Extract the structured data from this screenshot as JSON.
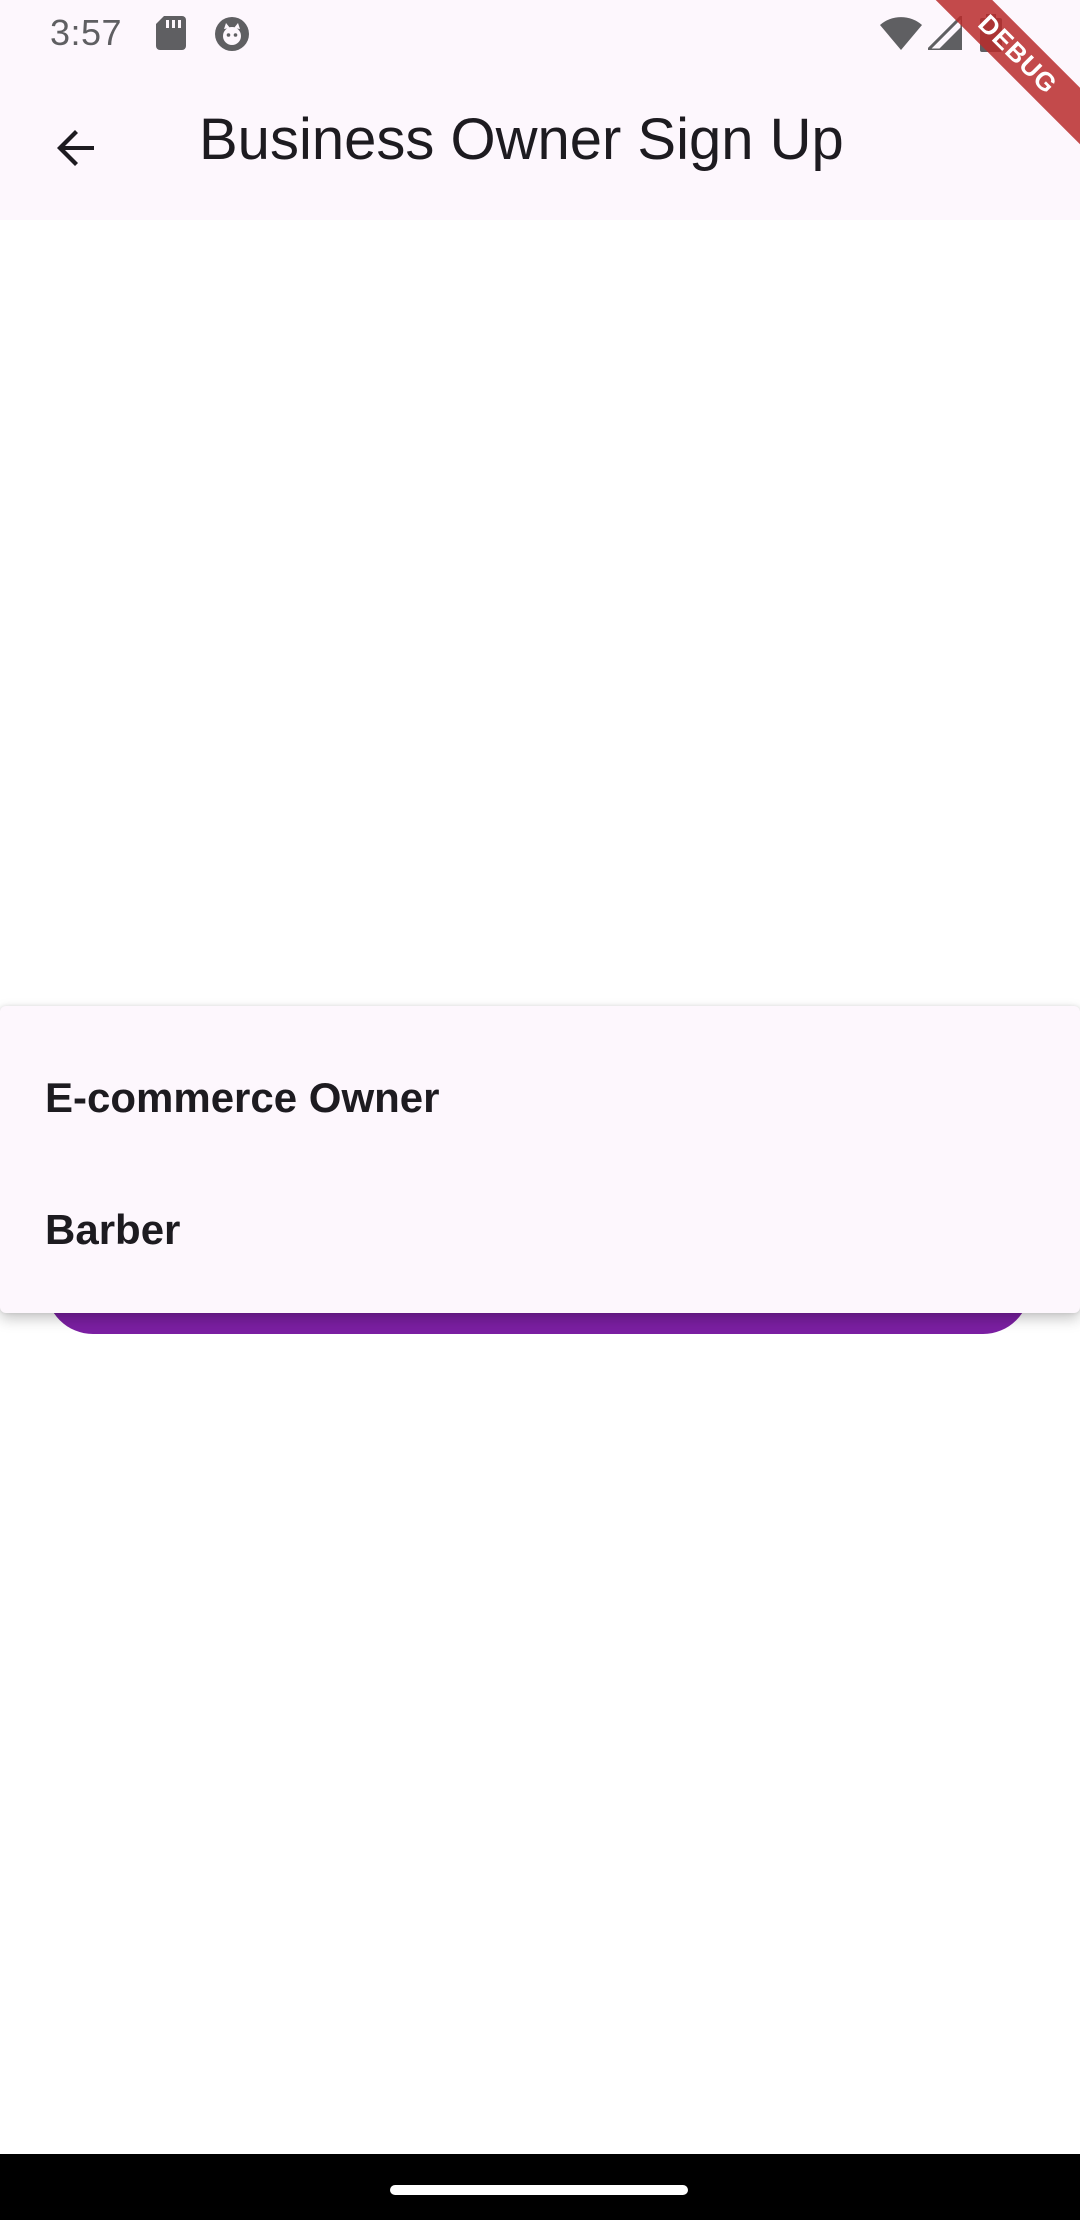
{
  "status_bar": {
    "time": "3:57",
    "icons": [
      "sd-card-icon",
      "app-notification-icon",
      "wifi-icon",
      "signal-icon",
      "battery-icon"
    ]
  },
  "app_bar": {
    "back_icon": "arrow-back-icon",
    "title": "Business Owner Sign Up"
  },
  "debug_banner": {
    "label": "DEBUG"
  },
  "dropdown": {
    "options": [
      {
        "label": "E-commerce Owner"
      },
      {
        "label": "Barber"
      }
    ]
  },
  "colors": {
    "surface": "#fdf7fd",
    "primary_button": "#7b1fa2",
    "text": "#1d1b20",
    "debug_ribbon": "#b82c2c"
  }
}
